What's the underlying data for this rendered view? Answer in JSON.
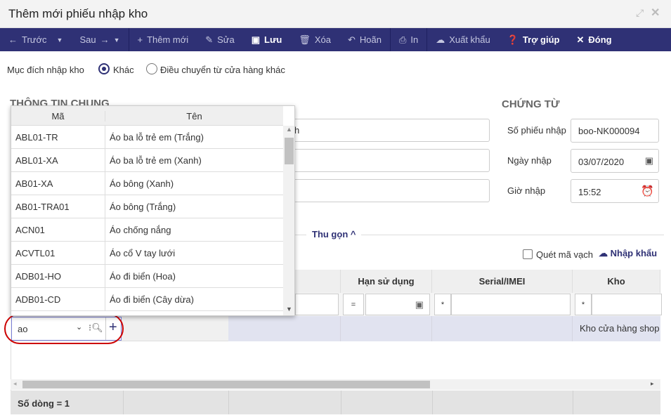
{
  "window": {
    "title": "Thêm mới phiếu nhập kho"
  },
  "toolbar": {
    "prev": "Trước",
    "next": "Sau",
    "add": "Thêm mới",
    "edit": "Sửa",
    "save": "Lưu",
    "delete": "Xóa",
    "undo": "Hoãn",
    "print": "In",
    "export": "Xuất khẩu",
    "help": "Trợ giúp",
    "close": "Đóng"
  },
  "purpose": {
    "label": "Mục đích nhập kho",
    "options": [
      "Khác",
      "Điều chuyển từ cửa hàng khác"
    ],
    "selected": "Khác"
  },
  "general": {
    "title": "THÔNG TIN CHUNG",
    "field1_value_partial": "h"
  },
  "voucher": {
    "title": "CHỨNG TỪ",
    "number_label": "Số phiếu nhập",
    "number": "boo-NK000094",
    "date_label": "Ngày nhập",
    "date": "03/07/2020",
    "time_label": "Giờ nhập",
    "time": "15:52"
  },
  "collapse": "Thu gọn",
  "barcode_label": "Quét mã vạch",
  "import_label": "Nhập khẩu",
  "grid": {
    "columns": [
      "",
      "",
      "",
      "Hạn sử dụng",
      "Serial/IMEI",
      "Kho"
    ],
    "filter_ops": [
      "=",
      "*",
      "*"
    ],
    "row": {
      "product_input": "ao",
      "warehouse": "Kho cửa hàng shop"
    },
    "footer": "Số dòng = 1"
  },
  "dropdown": {
    "headers": [
      "Mã",
      "Tên"
    ],
    "items": [
      {
        "code": "ABL01-TR",
        "name": "Áo ba lỗ trẻ em (Trắng)"
      },
      {
        "code": "ABL01-XA",
        "name": "Áo ba lỗ trẻ em (Xanh)"
      },
      {
        "code": "AB01-XA",
        "name": "Áo bông (Xanh)"
      },
      {
        "code": "AB01-TRA01",
        "name": "Áo bông (Trắng)"
      },
      {
        "code": "ACN01",
        "name": "Áo chống nắng"
      },
      {
        "code": "ACVTL01",
        "name": "Áo cổ V tay lưới"
      },
      {
        "code": "ADB01-HO",
        "name": "Áo đi biển (Hoa)"
      },
      {
        "code": "ADB01-CD",
        "name": "Áo đi biển (Cây dừa)"
      }
    ]
  }
}
